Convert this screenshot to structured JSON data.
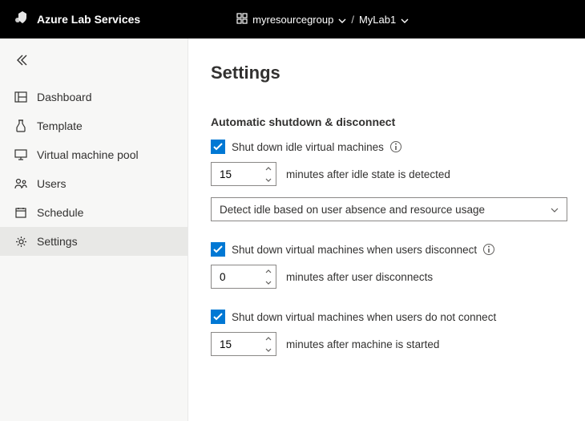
{
  "header": {
    "app_name": "Azure Lab Services",
    "resource_group": "myresourcegroup",
    "lab_name": "MyLab1"
  },
  "sidebar": {
    "items": [
      {
        "label": "Dashboard"
      },
      {
        "label": "Template"
      },
      {
        "label": "Virtual machine pool"
      },
      {
        "label": "Users"
      },
      {
        "label": "Schedule"
      },
      {
        "label": "Settings"
      }
    ]
  },
  "page": {
    "title": "Settings",
    "section_title": "Automatic shutdown & disconnect",
    "idle": {
      "checkbox_label": "Shut down idle virtual machines",
      "minutes": "15",
      "helper": "minutes after idle state is detected",
      "dropdown": "Detect idle based on user absence and resource usage"
    },
    "disconnect": {
      "checkbox_label": "Shut down virtual machines when users disconnect",
      "minutes": "0",
      "helper": "minutes after user disconnects"
    },
    "noconnect": {
      "checkbox_label": "Shut down virtual machines when users do not connect",
      "minutes": "15",
      "helper": "minutes after machine is started"
    }
  }
}
